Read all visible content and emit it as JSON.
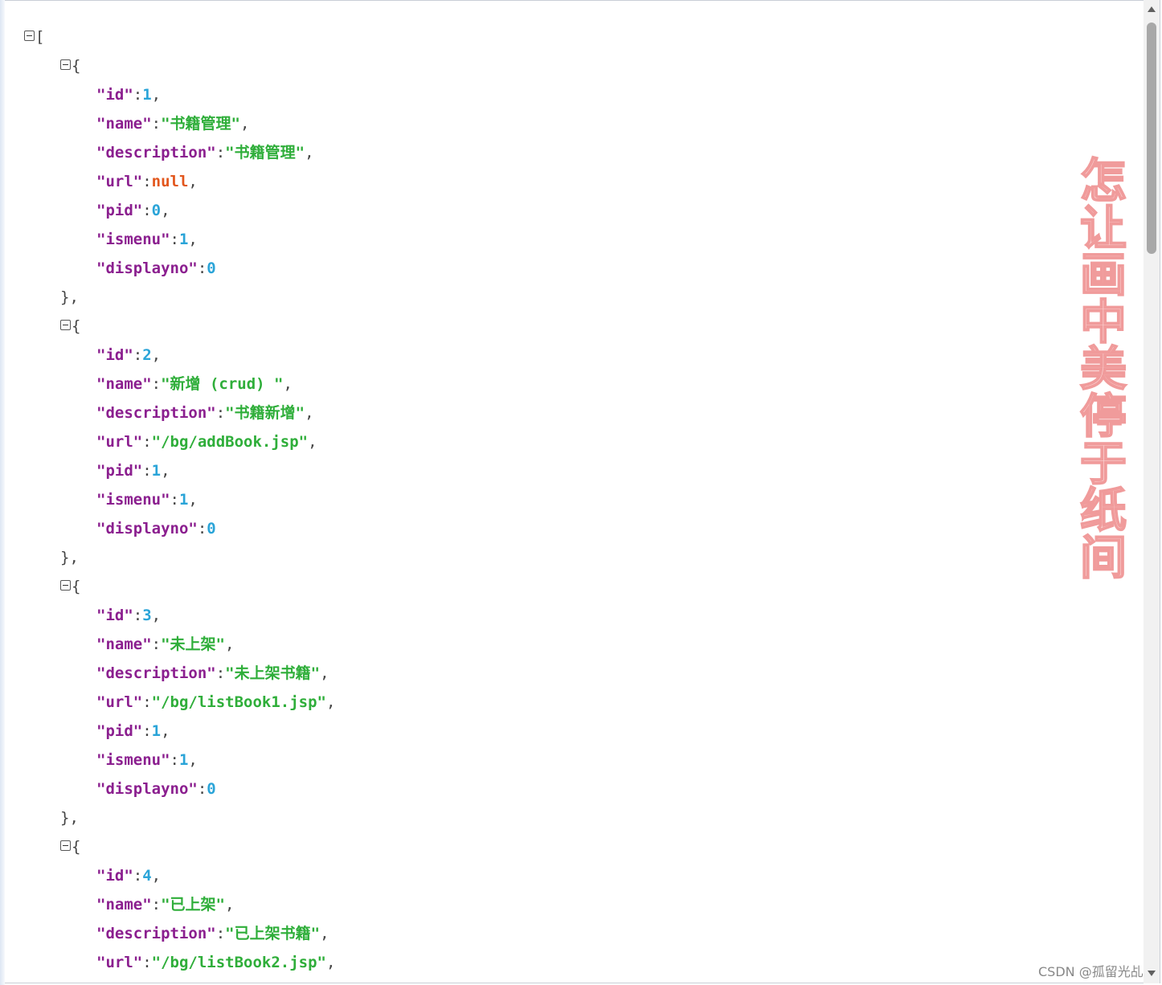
{
  "json_viewer": {
    "root_open": "[",
    "items": [
      {
        "open": "{",
        "fields": [
          {
            "key": "\"id\"",
            "value": "1",
            "type": "num",
            "sep": ","
          },
          {
            "key": "\"name\"",
            "value": "\"书籍管理\"",
            "type": "str",
            "sep": ","
          },
          {
            "key": "\"description\"",
            "value": "\"书籍管理\"",
            "type": "str",
            "sep": ","
          },
          {
            "key": "\"url\"",
            "value": "null",
            "type": "nul",
            "sep": ","
          },
          {
            "key": "\"pid\"",
            "value": "0",
            "type": "num",
            "sep": ","
          },
          {
            "key": "\"ismenu\"",
            "value": "1",
            "type": "num",
            "sep": ","
          },
          {
            "key": "\"displayno\"",
            "value": "0",
            "type": "num",
            "sep": ""
          }
        ],
        "close": "},"
      },
      {
        "open": "{",
        "fields": [
          {
            "key": "\"id\"",
            "value": "2",
            "type": "num",
            "sep": ","
          },
          {
            "key": "\"name\"",
            "value": "\"新增 (crud) \"",
            "type": "str",
            "sep": ","
          },
          {
            "key": "\"description\"",
            "value": "\"书籍新增\"",
            "type": "str",
            "sep": ","
          },
          {
            "key": "\"url\"",
            "value": "\"/bg/addBook.jsp\"",
            "type": "str",
            "sep": ","
          },
          {
            "key": "\"pid\"",
            "value": "1",
            "type": "num",
            "sep": ","
          },
          {
            "key": "\"ismenu\"",
            "value": "1",
            "type": "num",
            "sep": ","
          },
          {
            "key": "\"displayno\"",
            "value": "0",
            "type": "num",
            "sep": ""
          }
        ],
        "close": "},"
      },
      {
        "open": "{",
        "fields": [
          {
            "key": "\"id\"",
            "value": "3",
            "type": "num",
            "sep": ","
          },
          {
            "key": "\"name\"",
            "value": "\"未上架\"",
            "type": "str",
            "sep": ","
          },
          {
            "key": "\"description\"",
            "value": "\"未上架书籍\"",
            "type": "str",
            "sep": ","
          },
          {
            "key": "\"url\"",
            "value": "\"/bg/listBook1.jsp\"",
            "type": "str",
            "sep": ","
          },
          {
            "key": "\"pid\"",
            "value": "1",
            "type": "num",
            "sep": ","
          },
          {
            "key": "\"ismenu\"",
            "value": "1",
            "type": "num",
            "sep": ","
          },
          {
            "key": "\"displayno\"",
            "value": "0",
            "type": "num",
            "sep": ""
          }
        ],
        "close": "},"
      },
      {
        "open": "{",
        "fields": [
          {
            "key": "\"id\"",
            "value": "4",
            "type": "num",
            "sep": ","
          },
          {
            "key": "\"name\"",
            "value": "\"已上架\"",
            "type": "str",
            "sep": ","
          },
          {
            "key": "\"description\"",
            "value": "\"已上架书籍\"",
            "type": "str",
            "sep": ","
          },
          {
            "key": "\"url\"",
            "value": "\"/bg/listBook2.jsp\"",
            "type": "str",
            "sep": ","
          }
        ],
        "close": ""
      }
    ]
  },
  "watermark": "怎让画中美停于纸间",
  "footer": "CSDN @孤留光乩",
  "colors": {
    "key": "#8b1f8f",
    "string": "#2fae3a",
    "number": "#2aa4d8",
    "null": "#e2561c"
  },
  "icons": {
    "toggle": "collapse-minus-icon",
    "scroll_up": "scroll-up-arrow-icon",
    "scroll_down": "scroll-down-arrow-icon"
  }
}
